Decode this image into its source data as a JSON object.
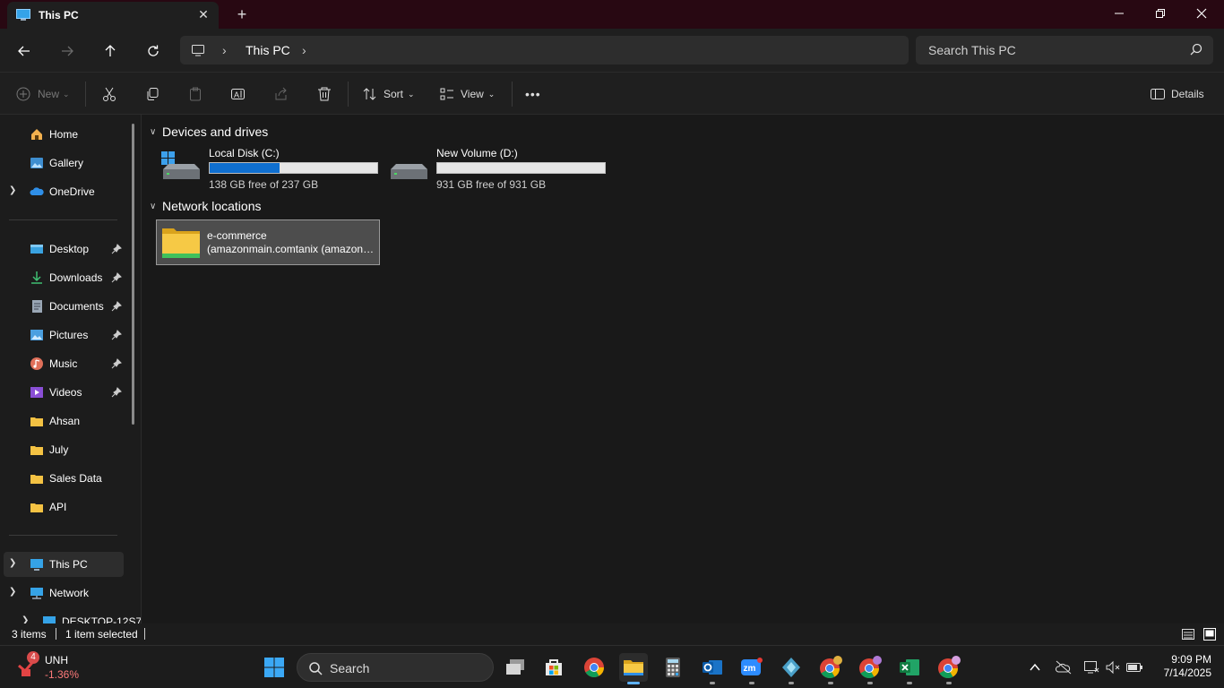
{
  "window": {
    "tab_title": "This PC",
    "new_tab_symbol": "+"
  },
  "address": {
    "crumb": "This PC",
    "search_placeholder": "Search This PC"
  },
  "toolbar": {
    "new_label": "New",
    "sort_label": "Sort",
    "view_label": "View",
    "more_label": "•••",
    "details_label": "Details"
  },
  "sidebar": {
    "top": [
      {
        "label": "Home",
        "icon": "home-icon"
      },
      {
        "label": "Gallery",
        "icon": "gallery-icon"
      },
      {
        "label": "OneDrive",
        "icon": "onedrive-icon"
      }
    ],
    "pinned": [
      {
        "label": "Desktop",
        "icon": "desktop-icon"
      },
      {
        "label": "Downloads",
        "icon": "downloads-icon"
      },
      {
        "label": "Documents",
        "icon": "documents-icon"
      },
      {
        "label": "Pictures",
        "icon": "pictures-icon"
      },
      {
        "label": "Music",
        "icon": "music-icon"
      },
      {
        "label": "Videos",
        "icon": "videos-icon"
      }
    ],
    "folders": [
      {
        "label": "Ahsan"
      },
      {
        "label": "July"
      },
      {
        "label": "Sales Data"
      },
      {
        "label": "API"
      }
    ],
    "bottom": [
      {
        "label": "This PC",
        "icon": "computer-icon",
        "selected": true
      },
      {
        "label": "Network",
        "icon": "network-icon"
      },
      {
        "label": "DESKTOP-12S7",
        "icon": "computer-icon"
      }
    ]
  },
  "content": {
    "groups": {
      "devices": "Devices and drives",
      "network": "Network locations"
    },
    "drives": [
      {
        "name": "Local Disk (C:)",
        "free_text": "138 GB free of 237 GB",
        "used_fraction": 0.418
      },
      {
        "name": "New Volume (D:)",
        "free_text": "931 GB free of 931 GB",
        "used_fraction": 0.0
      }
    ],
    "network_locations": [
      {
        "name": "e-commerce",
        "path": "(amazonmain.comtanix (amazonmain.com))"
      }
    ]
  },
  "status": {
    "items": "3 items",
    "selected": "1 item selected"
  },
  "taskbar": {
    "stock_symbol": "UNH",
    "stock_change": "-1.36%",
    "stock_badge": "4",
    "search_label": "Search",
    "time": "9:09 PM",
    "date": "7/14/2025"
  },
  "colors": {
    "titlebar": "#280812",
    "accent": "#0f6fd0",
    "background": "#191919"
  }
}
